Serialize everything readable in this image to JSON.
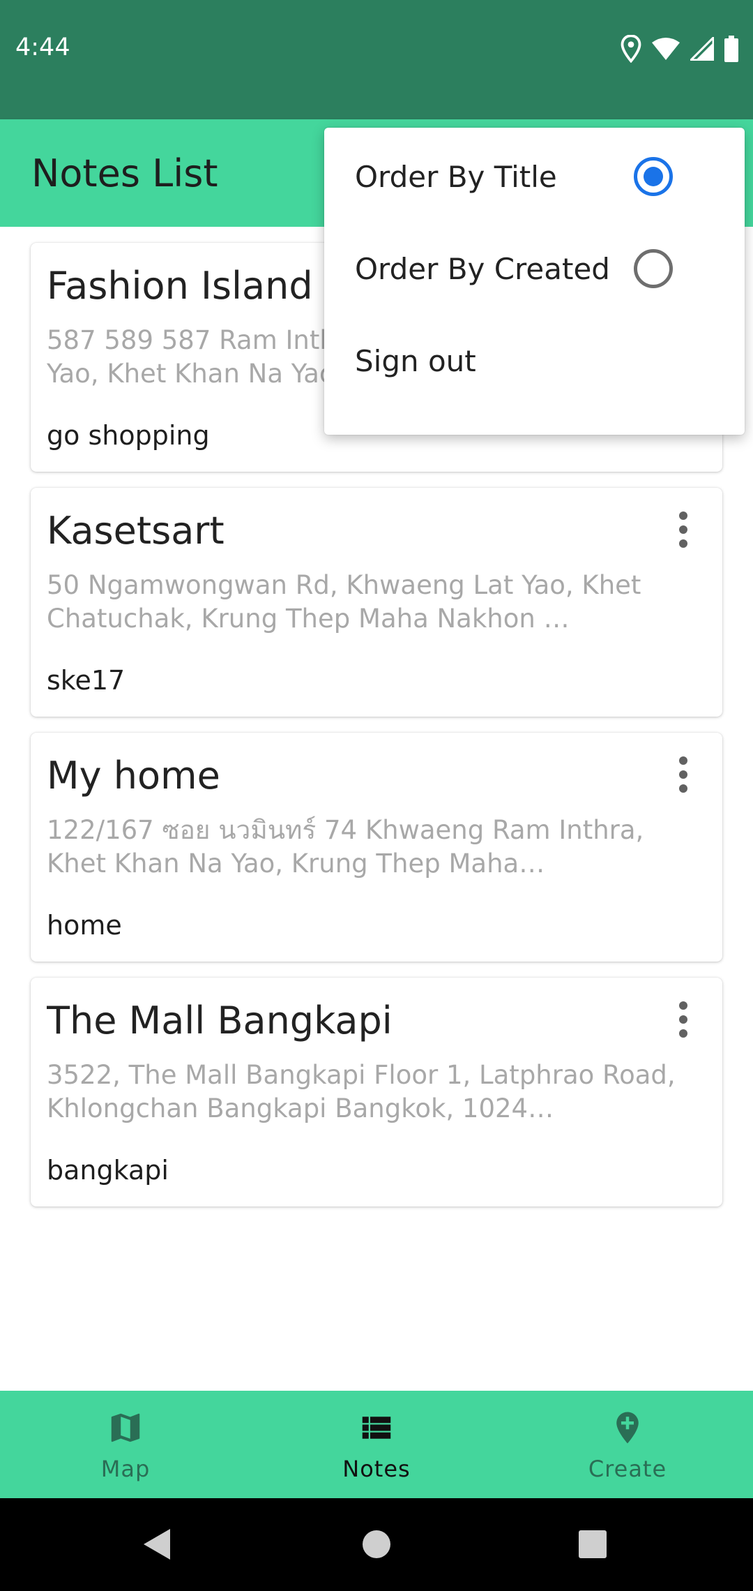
{
  "status_bar": {
    "time": "4:44",
    "icons": [
      "location-icon",
      "wifi-icon",
      "signal-icon",
      "battery-icon"
    ]
  },
  "app_bar": {
    "title": "Notes List"
  },
  "notes": [
    {
      "title": "Fashion Island",
      "address": "587 589 587 Ram Inthra Rd, Khwaeng Khan Na Yao, Khet Khan Na Yao, Krung Thep Maha Nakhon",
      "note": "go shopping"
    },
    {
      "title": "Kasetsart",
      "address": "50 Ngamwongwan Rd, Khwaeng Lat Yao, Khet Chatuchak, Krung Thep Maha Nakhon …",
      "note": "ske17"
    },
    {
      "title": "My home",
      "address": "122/167 ซอย นวมินทร์ 74 Khwaeng Ram Inthra, Khet Khan Na Yao, Krung Thep Maha…",
      "note": "home"
    },
    {
      "title": "The Mall Bangkapi",
      "address": "3522, The Mall Bangkapi Floor 1, Latphrao Road, Khlongchan Bangkapi Bangkok, 1024…",
      "note": "bangkapi"
    }
  ],
  "menu": {
    "items": [
      {
        "label": "Order By Title",
        "type": "radio",
        "checked": true
      },
      {
        "label": "Order By Created",
        "type": "radio",
        "checked": false
      },
      {
        "label": "Sign out",
        "type": "action"
      }
    ]
  },
  "bottom_nav": {
    "items": [
      {
        "label": "Map",
        "icon": "map-icon",
        "active": false
      },
      {
        "label": "Notes",
        "icon": "list-icon",
        "active": true
      },
      {
        "label": "Create",
        "icon": "add-location-icon",
        "active": false
      }
    ]
  },
  "colors": {
    "status_bar": "#2c7f5e",
    "app_bar": "#44d69c",
    "radio_checked": "#1a73e8",
    "nav_active": "#111111",
    "nav_inactive": "#2a6e55"
  }
}
